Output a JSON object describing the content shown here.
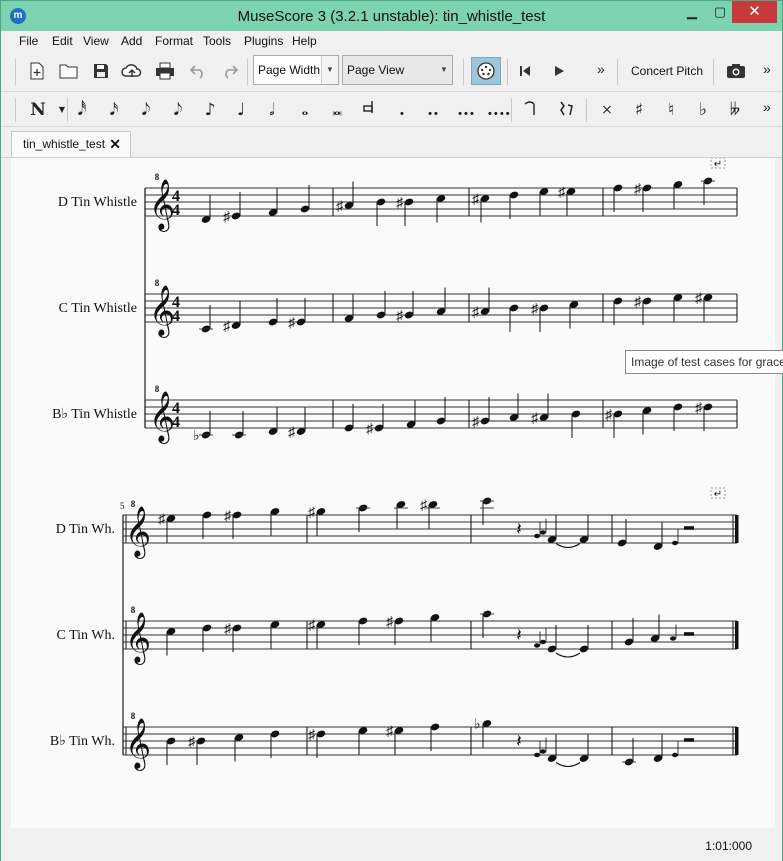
{
  "window": {
    "title": "MuseScore 3 (3.2.1 unstable): tin_whistle_test"
  },
  "menu": [
    "File",
    "Edit",
    "View",
    "Add",
    "Format",
    "Tools",
    "Plugins",
    "Help"
  ],
  "toolbar": {
    "zoom_value": "Page Width",
    "view_mode": "Page View",
    "concert_pitch_label": "Concert Pitch",
    "more_glyph": "»"
  },
  "note_input": {
    "durations": [
      "𝅘𝅥𝅰",
      "𝅘𝅥𝅯",
      "𝅘𝅥𝅮",
      "♪",
      "♩",
      "𝅗𝅥",
      "𝅝",
      "𝅜",
      "."
    ],
    "accidentals": [
      "×",
      "♯",
      "♮",
      "♭",
      "𝄫"
    ]
  },
  "tabs": [
    {
      "label": "tin_whistle_test",
      "close_glyph": "✕"
    }
  ],
  "score": {
    "system1_instruments": [
      "D Tin Whistle",
      "C Tin Whistle",
      "B♭ Tin Whistle"
    ],
    "system2_instruments": [
      "D Tin Wh.",
      "C Tin Wh.",
      "B♭ Tin Wh."
    ],
    "measure_number": "5",
    "clef_octave_mark": "8",
    "time_signature": [
      "4",
      "4"
    ]
  },
  "tooltip": "Image of test cases for grace",
  "status": {
    "time": "1:01:000"
  }
}
